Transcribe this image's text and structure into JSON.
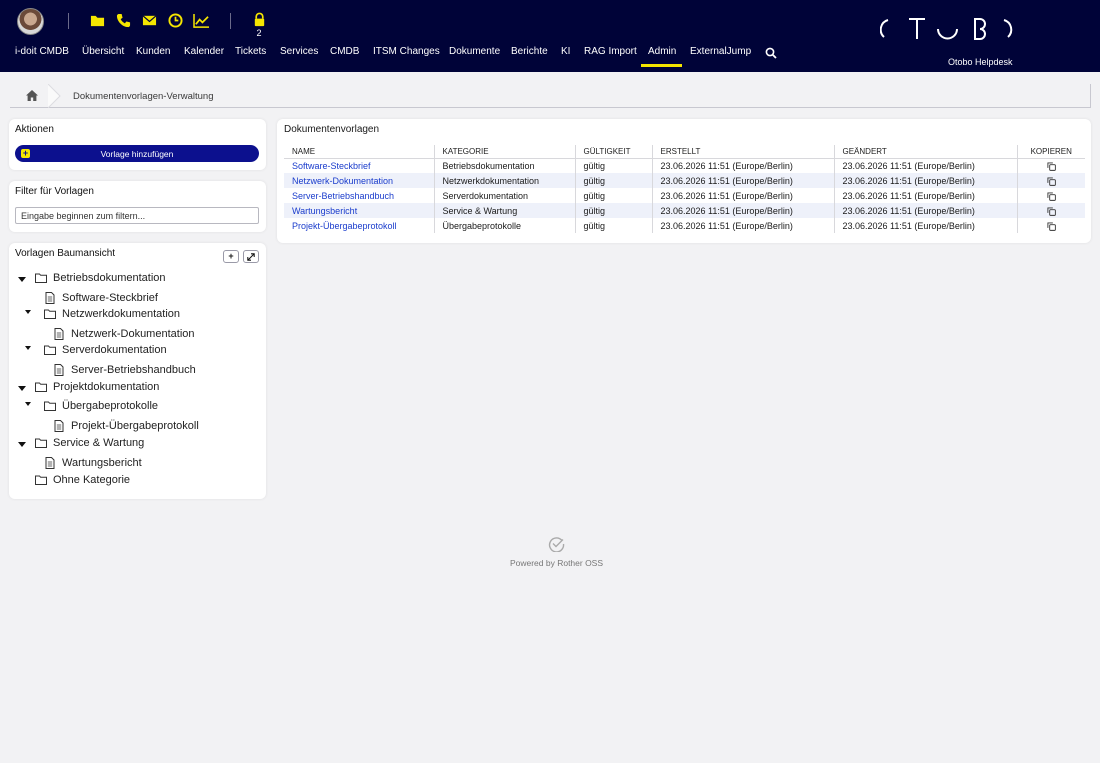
{
  "header": {
    "lock_count": "2",
    "brand": "Otobo Helpdesk",
    "nav": [
      {
        "label": "i-doit CMDB"
      },
      {
        "label": "Übersicht"
      },
      {
        "label": "Kunden"
      },
      {
        "label": "Kalender"
      },
      {
        "label": "Tickets"
      },
      {
        "label": "Services"
      },
      {
        "label": "CMDB"
      },
      {
        "label": "ITSM Changes"
      },
      {
        "label": "Dokumente"
      },
      {
        "label": "Berichte"
      },
      {
        "label": "KI"
      },
      {
        "label": "RAG Import"
      },
      {
        "label": "Admin"
      },
      {
        "label": "ExternalJump"
      }
    ],
    "active_nav": "Admin",
    "colors": {
      "background": "#000338",
      "accent": "#f5e600"
    }
  },
  "breadcrumb": {
    "current": "Dokumentenvorlagen-Verwaltung"
  },
  "actions": {
    "title": "Aktionen",
    "add_label": "Vorlage hinzufügen"
  },
  "filter": {
    "title": "Filter für Vorlagen",
    "placeholder": "Eingabe beginnen zum filtern..."
  },
  "tree": {
    "title": "Vorlagen Baumansicht",
    "nodes": [
      {
        "label": "Betriebsdokumentation",
        "type": "folder"
      },
      {
        "label": "Software-Steckbrief",
        "type": "document"
      },
      {
        "label": "Netzwerkdokumentation",
        "type": "folder"
      },
      {
        "label": "Netzwerk-Dokumentation",
        "type": "document"
      },
      {
        "label": "Serverdokumentation",
        "type": "folder"
      },
      {
        "label": "Server-Betriebshandbuch",
        "type": "document"
      },
      {
        "label": "Projektdokumentation",
        "type": "folder"
      },
      {
        "label": "Übergabeprotokolle",
        "type": "folder"
      },
      {
        "label": "Projekt-Übergabeprotokoll",
        "type": "document"
      },
      {
        "label": "Service & Wartung",
        "type": "folder"
      },
      {
        "label": "Wartungsbericht",
        "type": "document"
      },
      {
        "label": "Ohne Kategorie",
        "type": "folder"
      }
    ]
  },
  "templates": {
    "title": "Dokumentenvorlagen",
    "columns": [
      "NAME",
      "KATEGORIE",
      "GÜLTIGKEIT",
      "ERSTELLT",
      "GEÄNDERT",
      "KOPIEREN"
    ],
    "rows": [
      {
        "name": "Software-Steckbrief",
        "category": "Betriebsdokumentation",
        "validity": "gültig",
        "created": "23.06.2026 11:51 (Europe/Berlin)",
        "changed": "23.06.2026 11:51 (Europe/Berlin)"
      },
      {
        "name": "Netzwerk-Dokumentation",
        "category": "Netzwerkdokumentation",
        "validity": "gültig",
        "created": "23.06.2026 11:51 (Europe/Berlin)",
        "changed": "23.06.2026 11:51 (Europe/Berlin)"
      },
      {
        "name": "Server-Betriebshandbuch",
        "category": "Serverdokumentation",
        "validity": "gültig",
        "created": "23.06.2026 11:51 (Europe/Berlin)",
        "changed": "23.06.2026 11:51 (Europe/Berlin)"
      },
      {
        "name": "Wartungsbericht",
        "category": "Service & Wartung",
        "validity": "gültig",
        "created": "23.06.2026 11:51 (Europe/Berlin)",
        "changed": "23.06.2026 11:51 (Europe/Berlin)"
      },
      {
        "name": "Projekt-Übergabeprotokoll",
        "category": "Übergabeprotokolle",
        "validity": "gültig",
        "created": "23.06.2026 11:51 (Europe/Berlin)",
        "changed": "23.06.2026 11:51 (Europe/Berlin)"
      }
    ]
  },
  "footer": {
    "text": "Powered by Rother OSS"
  }
}
